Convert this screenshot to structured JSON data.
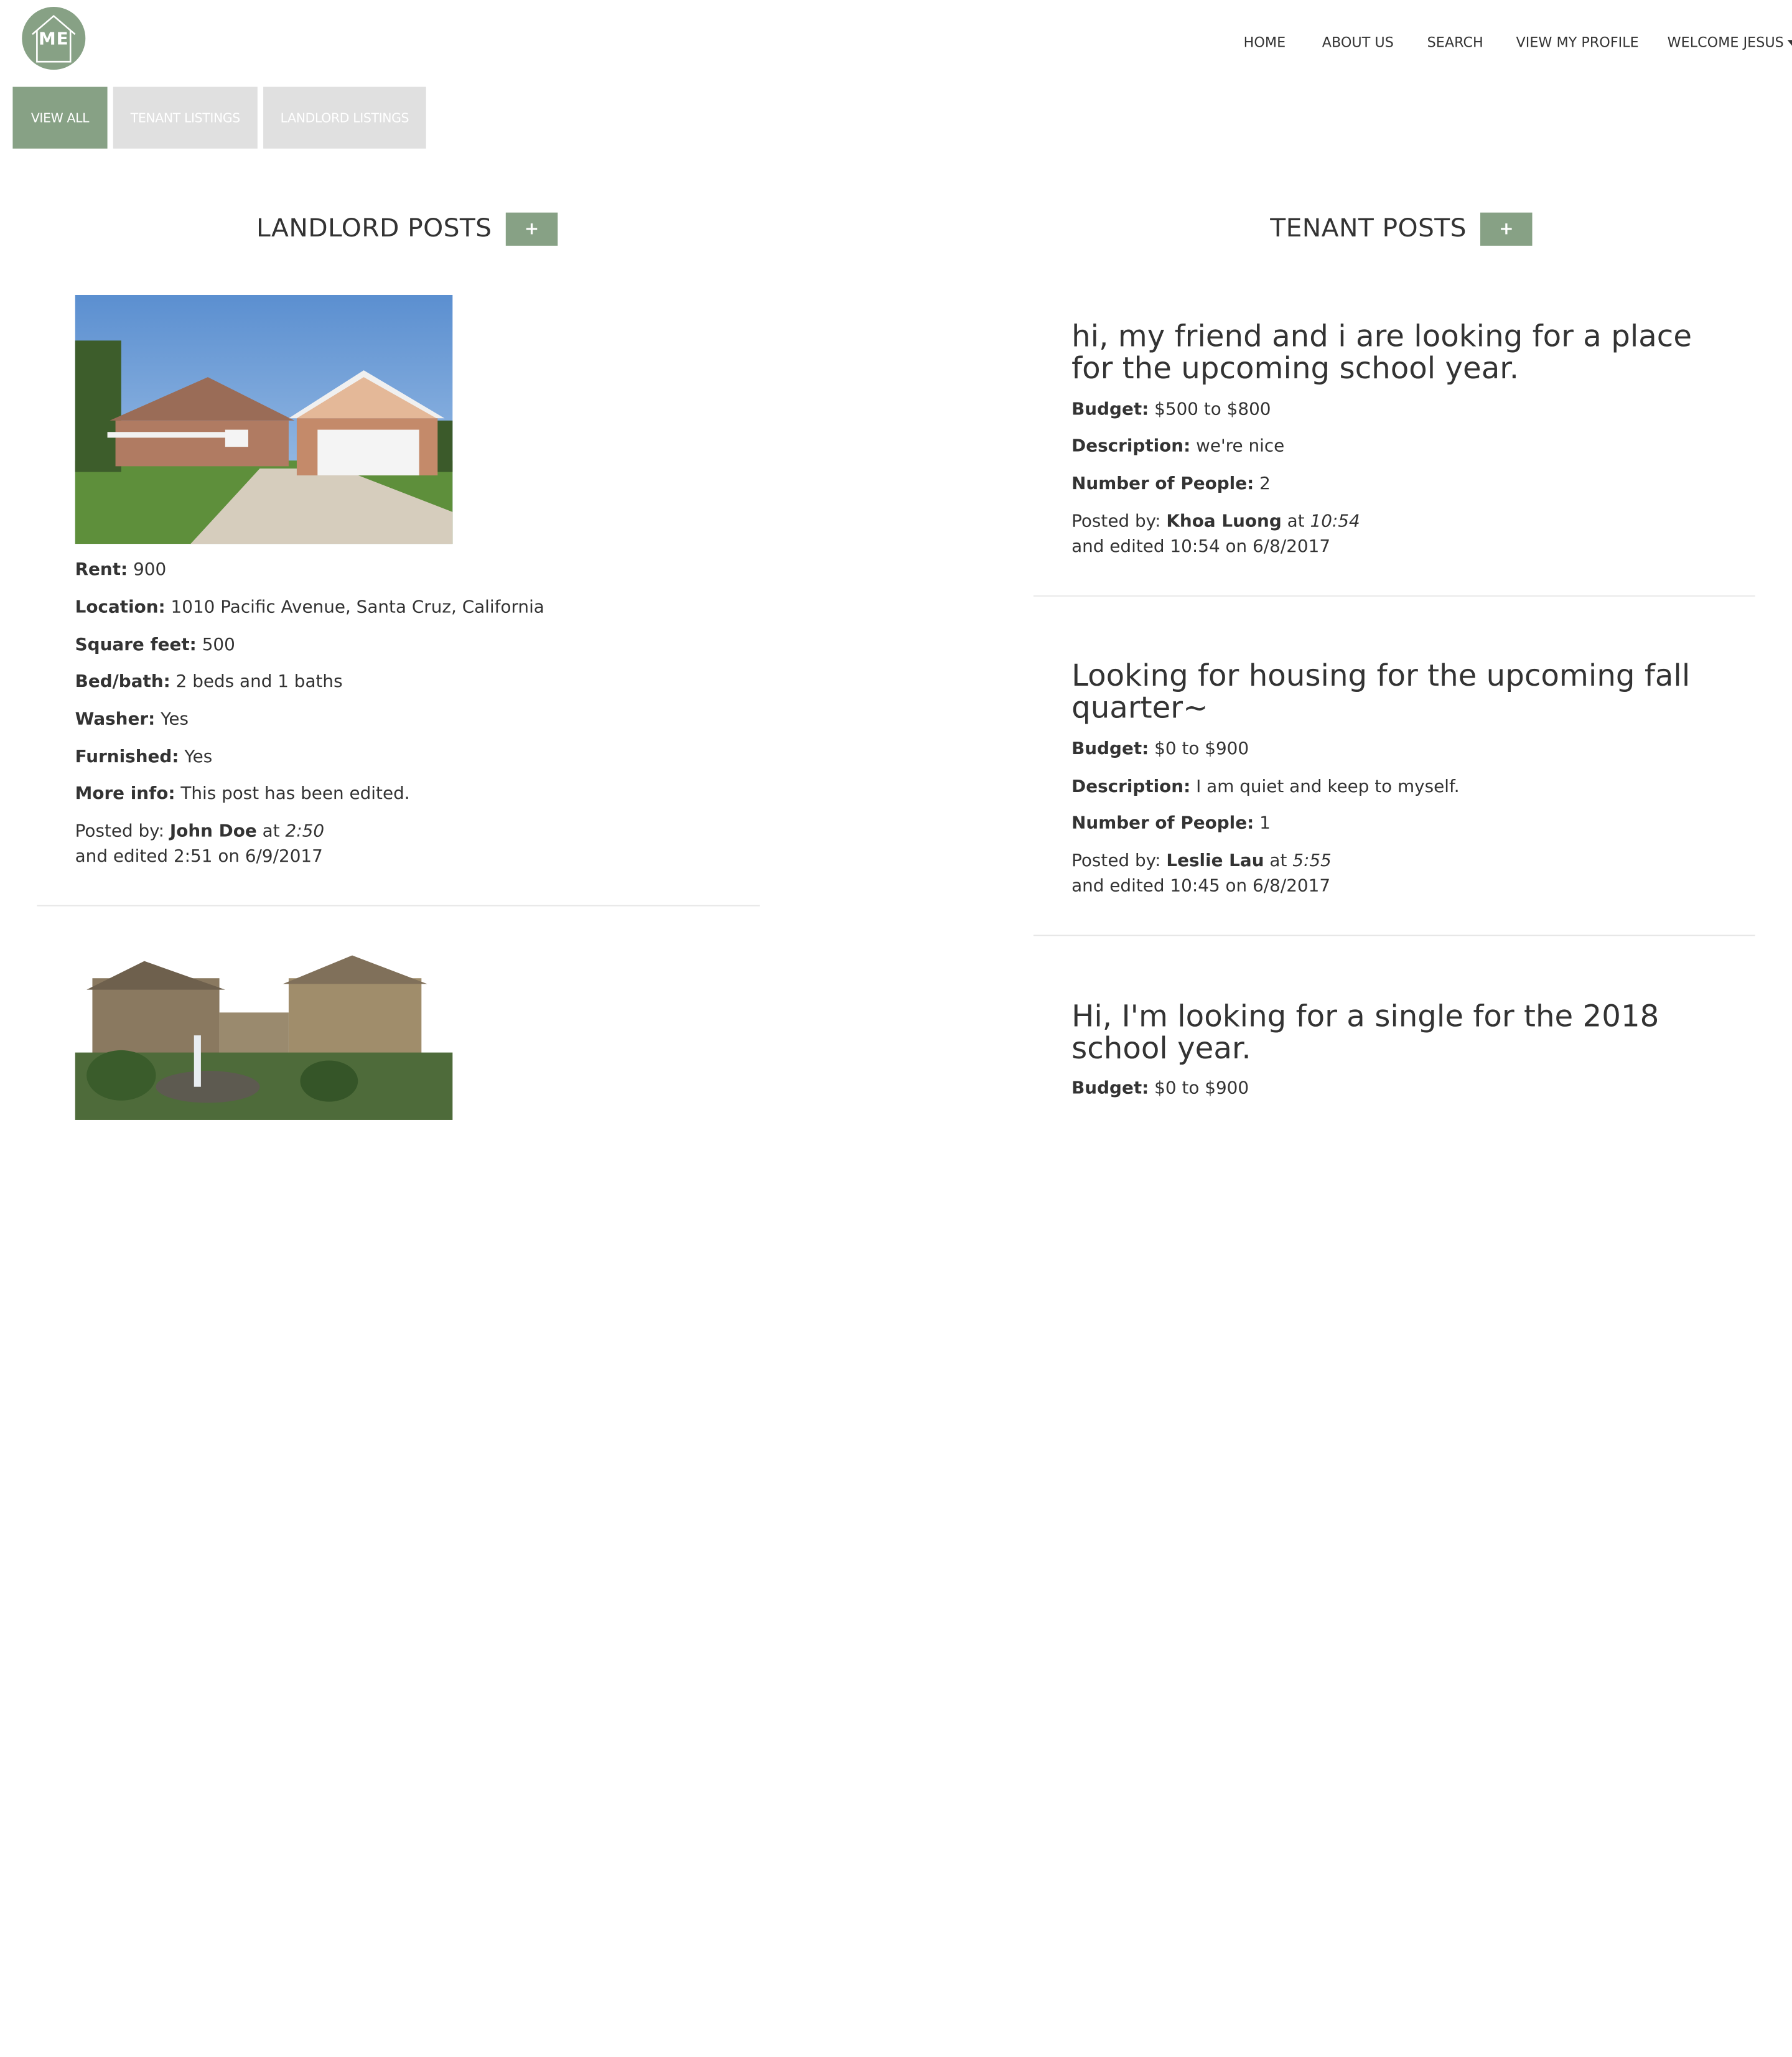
{
  "brand": {
    "logo_text": "ME"
  },
  "nav": {
    "items": [
      "HOME",
      "ABOUT US",
      "SEARCH",
      "VIEW MY PROFILE"
    ],
    "welcome": "WELCOME JESUS"
  },
  "filters": {
    "view_all": "VIEW ALL",
    "tenant_listings": "TENANT LISTINGS",
    "landlord_listings": "LANDLORD LISTINGS"
  },
  "landlord": {
    "title": "LANDLORD POSTS",
    "add_label": "+",
    "labels": {
      "rent": "Rent:",
      "location": "Location:",
      "square_feet": "Square feet:",
      "bed_bath": "Bed/bath:",
      "washer": "Washer:",
      "furnished": "Furnished:",
      "more_info": "More info:",
      "posted_by": "Posted by:",
      "at": "at",
      "and_edited": "and edited"
    },
    "posts": [
      {
        "rent": "900",
        "location": "1010 Pacific Avenue, Santa Cruz, California",
        "square_feet": "500",
        "bed_bath": "2 beds and 1 baths",
        "washer": "Yes",
        "furnished": "Yes",
        "more_info": "This post has been edited.",
        "author": "John Doe",
        "time": "2:50",
        "edited": "2:51 on 6/9/2017"
      }
    ]
  },
  "tenant": {
    "title": "TENANT POSTS",
    "add_label": "+",
    "labels": {
      "budget": "Budget:",
      "description": "Description:",
      "people": "Number of People:",
      "posted_by": "Posted by:",
      "at": "at",
      "and_edited": "and edited"
    },
    "posts": [
      {
        "title": "hi, my friend and i are looking for a place for the upcoming school year.",
        "budget": "$500 to $800",
        "description": "we're nice",
        "people": "2",
        "author": "Khoa Luong",
        "time": "10:54",
        "edited": "10:54 on 6/8/2017"
      },
      {
        "title": "Looking for housing for the upcoming fall quarter~",
        "budget": "$0 to $900",
        "description": "I am quiet and keep to myself.",
        "people": "1",
        "author": "Leslie Lau",
        "time": "5:55",
        "edited": "10:45 on 6/8/2017"
      },
      {
        "title": "Hi, I'm looking for a single for the 2018 school year.",
        "budget": "$0 to $900"
      }
    ]
  },
  "colors": {
    "accent": "#87a185",
    "inactive": "#e0e0e0",
    "text": "#333333",
    "divider": "#e6e6e6"
  }
}
